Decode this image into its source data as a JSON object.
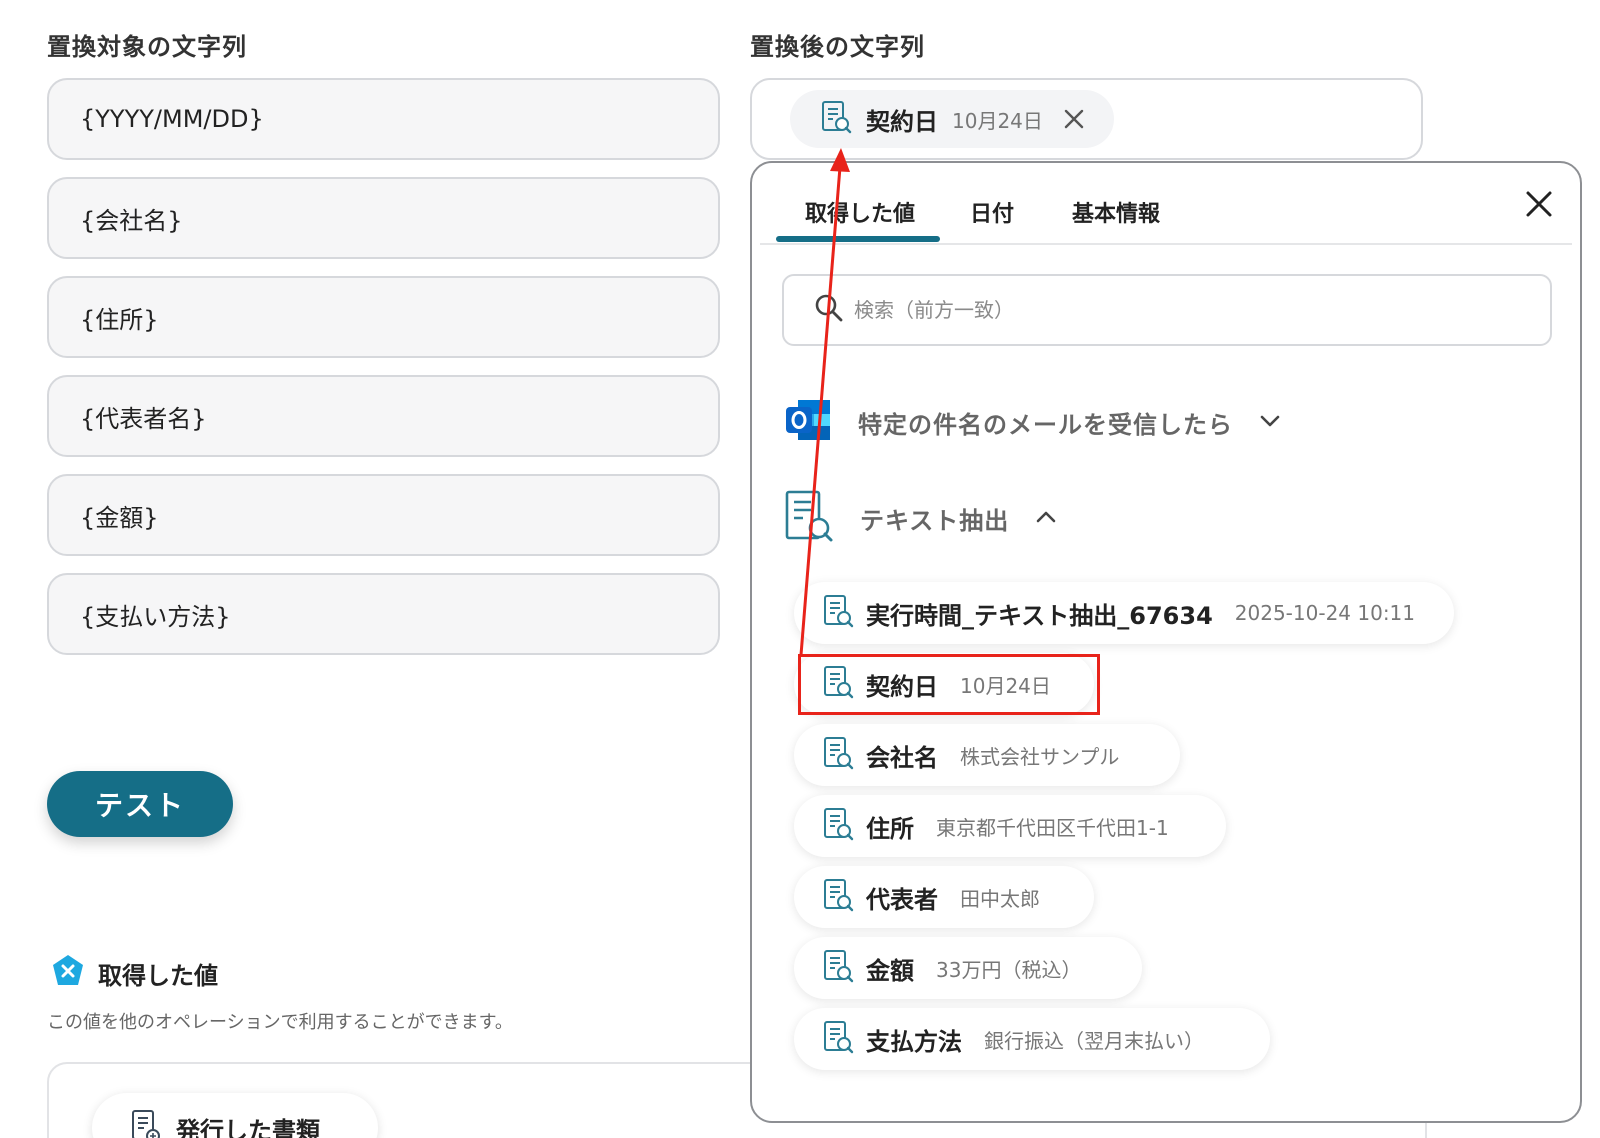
{
  "left_column": {
    "title": "置換対象の文字列",
    "fields": [
      "{YYYY/MM/DD}",
      "{会社名}",
      "{住所}",
      "{代表者名}",
      "{金額}",
      "{支払い方法}"
    ]
  },
  "right_column": {
    "title": "置換後の文字列",
    "selected_chip": {
      "label": "契約日",
      "value": "10月24日"
    }
  },
  "test_button": {
    "label": "テスト"
  },
  "acquired_section": {
    "title": "取得した値",
    "description": "この値を他のオペレーションで利用することができます。",
    "issued_chip_label": "発行した書類"
  },
  "popover": {
    "tabs": [
      "取得した値",
      "日付",
      "基本情報"
    ],
    "active_tab": 0,
    "search_placeholder": "検索（前方一致）",
    "groups": [
      {
        "label": "特定の件名のメールを受信したら",
        "icon": "outlook-icon",
        "expanded": false
      },
      {
        "label": "テキスト抽出",
        "icon": "document-search-icon",
        "expanded": true
      }
    ],
    "items": [
      {
        "label": "実行時間_テキスト抽出_67634",
        "value": "2025-10-24 10:11"
      },
      {
        "label": "契約日",
        "value": "10月24日"
      },
      {
        "label": "会社名",
        "value": "株式会社サンプル"
      },
      {
        "label": "住所",
        "value": "東京都千代田区千代田1-1"
      },
      {
        "label": "代表者",
        "value": "田中太郎"
      },
      {
        "label": "金額",
        "value": "33万円（税込）"
      },
      {
        "label": "支払方法",
        "value": "銀行振込（翌月末払い）"
      }
    ]
  },
  "colors": {
    "accent": "#156e87",
    "annotation": "#e8231a",
    "outlook_blue": "#0a64c8"
  }
}
